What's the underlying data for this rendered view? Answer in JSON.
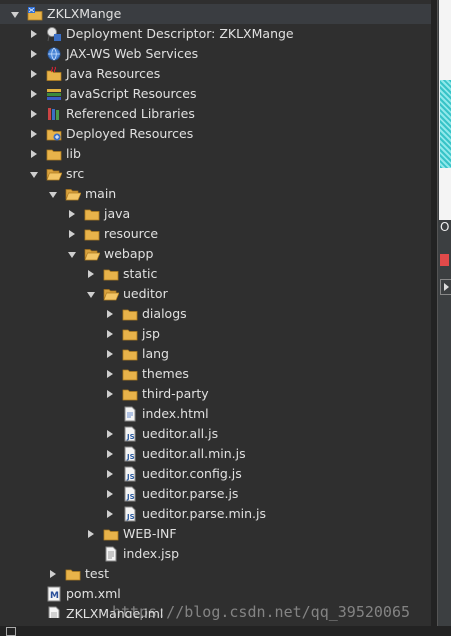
{
  "tree": [
    {
      "label": "ZKLXMange",
      "depth": 0,
      "twisty": "open",
      "icon": "project-icon",
      "selected": true
    },
    {
      "label": "Deployment Descriptor: ZKLXMange",
      "depth": 1,
      "twisty": "closed",
      "icon": "deployment-descriptor-icon"
    },
    {
      "label": "JAX-WS Web Services",
      "depth": 1,
      "twisty": "closed",
      "icon": "web-services-icon"
    },
    {
      "label": "Java Resources",
      "depth": 1,
      "twisty": "closed",
      "icon": "java-resources-icon"
    },
    {
      "label": "JavaScript Resources",
      "depth": 1,
      "twisty": "closed",
      "icon": "javascript-resources-icon"
    },
    {
      "label": "Referenced Libraries",
      "depth": 1,
      "twisty": "closed",
      "icon": "referenced-libraries-icon"
    },
    {
      "label": "Deployed Resources",
      "depth": 1,
      "twisty": "closed",
      "icon": "deployed-resources-icon"
    },
    {
      "label": "lib",
      "depth": 1,
      "twisty": "closed",
      "icon": "folder-icon"
    },
    {
      "label": "src",
      "depth": 1,
      "twisty": "open",
      "icon": "open-folder-icon"
    },
    {
      "label": "main",
      "depth": 2,
      "twisty": "open",
      "icon": "open-folder-icon"
    },
    {
      "label": "java",
      "depth": 3,
      "twisty": "closed",
      "icon": "folder-icon"
    },
    {
      "label": "resource",
      "depth": 3,
      "twisty": "closed",
      "icon": "folder-icon"
    },
    {
      "label": "webapp",
      "depth": 3,
      "twisty": "open",
      "icon": "open-folder-icon"
    },
    {
      "label": "static",
      "depth": 4,
      "twisty": "closed",
      "icon": "folder-icon"
    },
    {
      "label": "ueditor",
      "depth": 4,
      "twisty": "open",
      "icon": "open-folder-icon"
    },
    {
      "label": "dialogs",
      "depth": 5,
      "twisty": "closed",
      "icon": "folder-icon"
    },
    {
      "label": "jsp",
      "depth": 5,
      "twisty": "closed",
      "icon": "folder-icon"
    },
    {
      "label": "lang",
      "depth": 5,
      "twisty": "closed",
      "icon": "folder-icon"
    },
    {
      "label": "themes",
      "depth": 5,
      "twisty": "closed",
      "icon": "folder-icon"
    },
    {
      "label": "third-party",
      "depth": 5,
      "twisty": "closed",
      "icon": "folder-icon"
    },
    {
      "label": "index.html",
      "depth": 5,
      "twisty": "none",
      "icon": "html-file-icon"
    },
    {
      "label": "ueditor.all.js",
      "depth": 5,
      "twisty": "closed",
      "icon": "js-file-icon"
    },
    {
      "label": "ueditor.all.min.js",
      "depth": 5,
      "twisty": "closed",
      "icon": "js-file-icon"
    },
    {
      "label": "ueditor.config.js",
      "depth": 5,
      "twisty": "closed",
      "icon": "js-file-icon"
    },
    {
      "label": "ueditor.parse.js",
      "depth": 5,
      "twisty": "closed",
      "icon": "js-file-icon"
    },
    {
      "label": "ueditor.parse.min.js",
      "depth": 5,
      "twisty": "closed",
      "icon": "js-file-icon"
    },
    {
      "label": "WEB-INF",
      "depth": 4,
      "twisty": "closed",
      "icon": "folder-icon"
    },
    {
      "label": "index.jsp",
      "depth": 4,
      "twisty": "none",
      "icon": "jsp-file-icon"
    },
    {
      "label": "test",
      "depth": 2,
      "twisty": "closed",
      "icon": "folder-icon"
    },
    {
      "label": "pom.xml",
      "depth": 1,
      "twisty": "none",
      "icon": "maven-pom-icon"
    },
    {
      "label": "ZKLXMange.iml",
      "depth": 1,
      "twisty": "none",
      "icon": "iml-file-icon"
    }
  ],
  "side_panel": {
    "label": "O"
  },
  "watermark": "https://blog.csdn.net/qq_39520065"
}
